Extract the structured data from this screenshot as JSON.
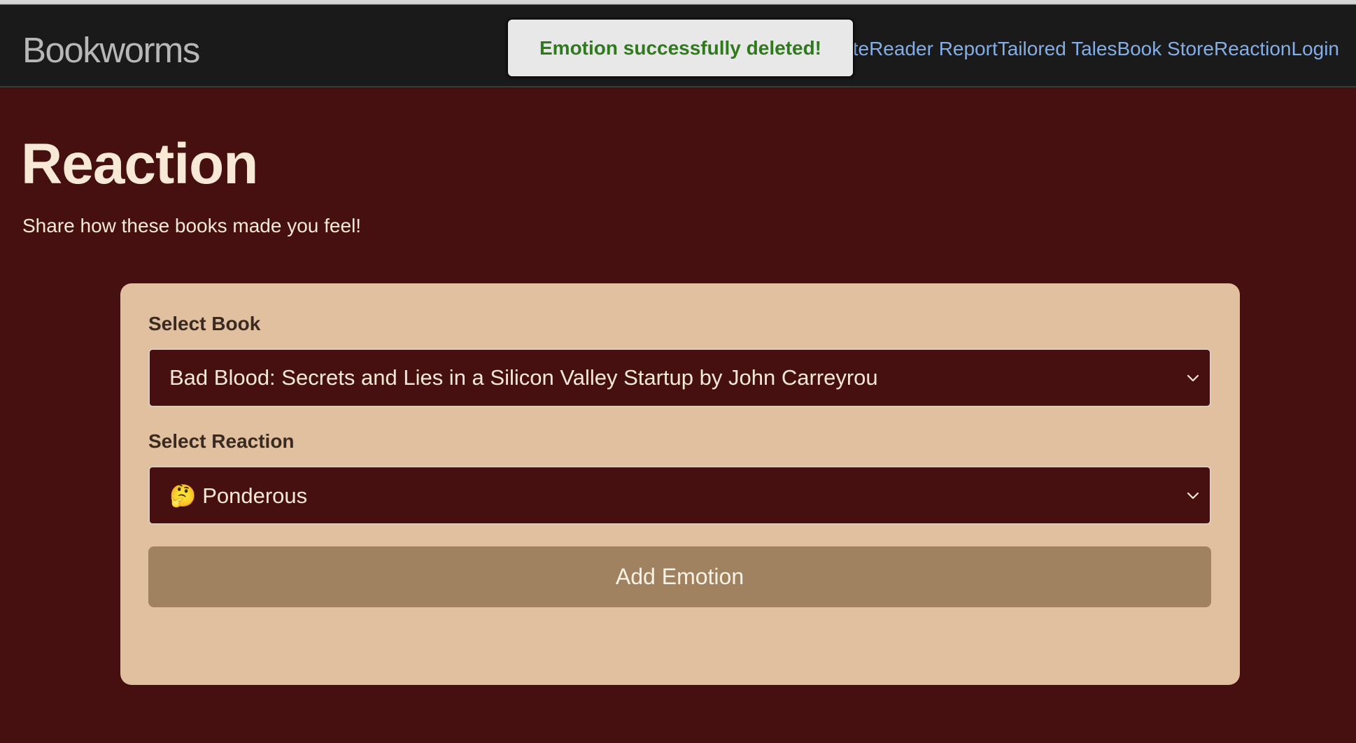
{
  "navbar": {
    "brand": "Bookworms",
    "links": [
      "ette",
      "Reader Report",
      "Tailored Tales",
      "Book Store",
      "Reaction",
      "Login"
    ]
  },
  "toast": {
    "message": "Emotion successfully deleted!"
  },
  "page": {
    "title": "Reaction",
    "subtitle": "Share how these books made you feel!"
  },
  "form": {
    "book_label": "Select Book",
    "book_selected": "Bad Blood: Secrets and Lies in a Silicon Valley Startup by John Carreyrou",
    "reaction_label": "Select Reaction",
    "reaction_selected": "🤔 Ponderous",
    "submit_label": "Add Emotion"
  },
  "colors": {
    "background": "#461010",
    "navbar": "#1a1a1a",
    "link": "#84aee6",
    "card": "#e0c09f",
    "button": "#a08260",
    "toast_text": "#2f7a1d"
  }
}
